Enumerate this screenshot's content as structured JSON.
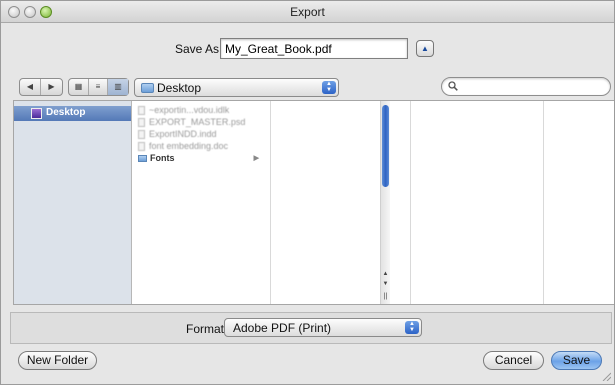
{
  "window": {
    "title": "Export",
    "traffic_lights": [
      "close-button",
      "minimize-button",
      "zoom-button"
    ]
  },
  "save_as": {
    "label": "Save As:",
    "value": "My_Great_Book.pdf",
    "expand_icon": "triangle-up-icon"
  },
  "toolbar": {
    "back_icon": "triangle-left",
    "forward_icon": "triangle-right",
    "view_modes": [
      "icon-view",
      "list-view",
      "column-view"
    ],
    "active_view": "column-view",
    "location": "Desktop",
    "search_placeholder": ""
  },
  "sidebar": {
    "items": [
      {
        "label": "Desktop",
        "selected": true
      }
    ]
  },
  "files": [
    {
      "name": "~exportin...vdou.idlk",
      "kind": "file",
      "dimmed": true
    },
    {
      "name": "EXPORT_MASTER.psd",
      "kind": "file",
      "dimmed": true
    },
    {
      "name": "ExportINDD.indd",
      "kind": "file",
      "dimmed": true
    },
    {
      "name": "font embedding.doc",
      "kind": "file",
      "dimmed": true
    },
    {
      "name": "Fonts",
      "kind": "folder",
      "dimmed": false
    }
  ],
  "format": {
    "label": "Format:",
    "value": "Adobe PDF (Print)"
  },
  "buttons": {
    "new_folder": "New Folder",
    "cancel": "Cancel",
    "save": "Save"
  },
  "colors": {
    "selection": "#5479b7",
    "scroll_thumb": "#2f63c3",
    "primary_button": "#6ca2e7",
    "sidebar_bg": "#dce2ea"
  }
}
